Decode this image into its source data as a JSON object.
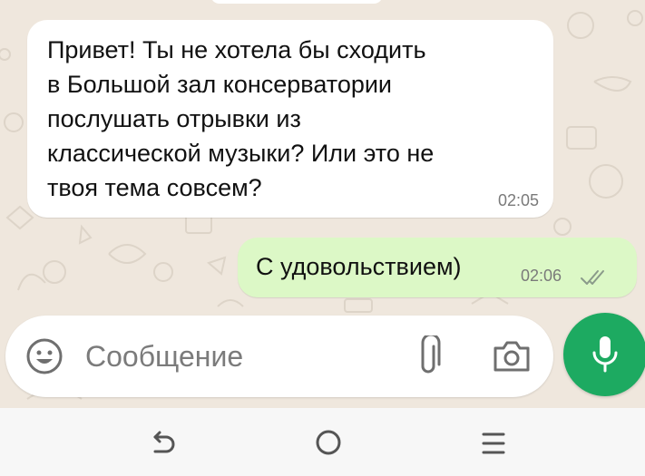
{
  "messages": [
    {
      "direction": "incoming",
      "lines": [
        "Привет! Ты не хотела бы сходить",
        "в Большой зал консерватории",
        "послушать отрывки из",
        "классической музыки? Или это не",
        "твоя тема совсем?"
      ],
      "time": "02:05"
    },
    {
      "direction": "outgoing",
      "text": "С удовольствием)",
      "time": "02:06",
      "status": "read",
      "status_icon": "double-check-icon"
    }
  ],
  "composer": {
    "placeholder": "Сообщение",
    "value": ""
  },
  "icons": {
    "emoji": "emoji-icon",
    "attach": "paperclip-icon",
    "camera": "camera-icon",
    "mic": "microphone-icon",
    "nav_back": "back-icon",
    "nav_home": "home-icon",
    "nav_recents": "recents-icon"
  },
  "colors": {
    "chat_background": "#efe7dd",
    "incoming_bubble": "#ffffff",
    "outgoing_bubble": "#dcf8c6",
    "mic_button": "#1daa61",
    "timestamp": "#7a7a7a"
  }
}
